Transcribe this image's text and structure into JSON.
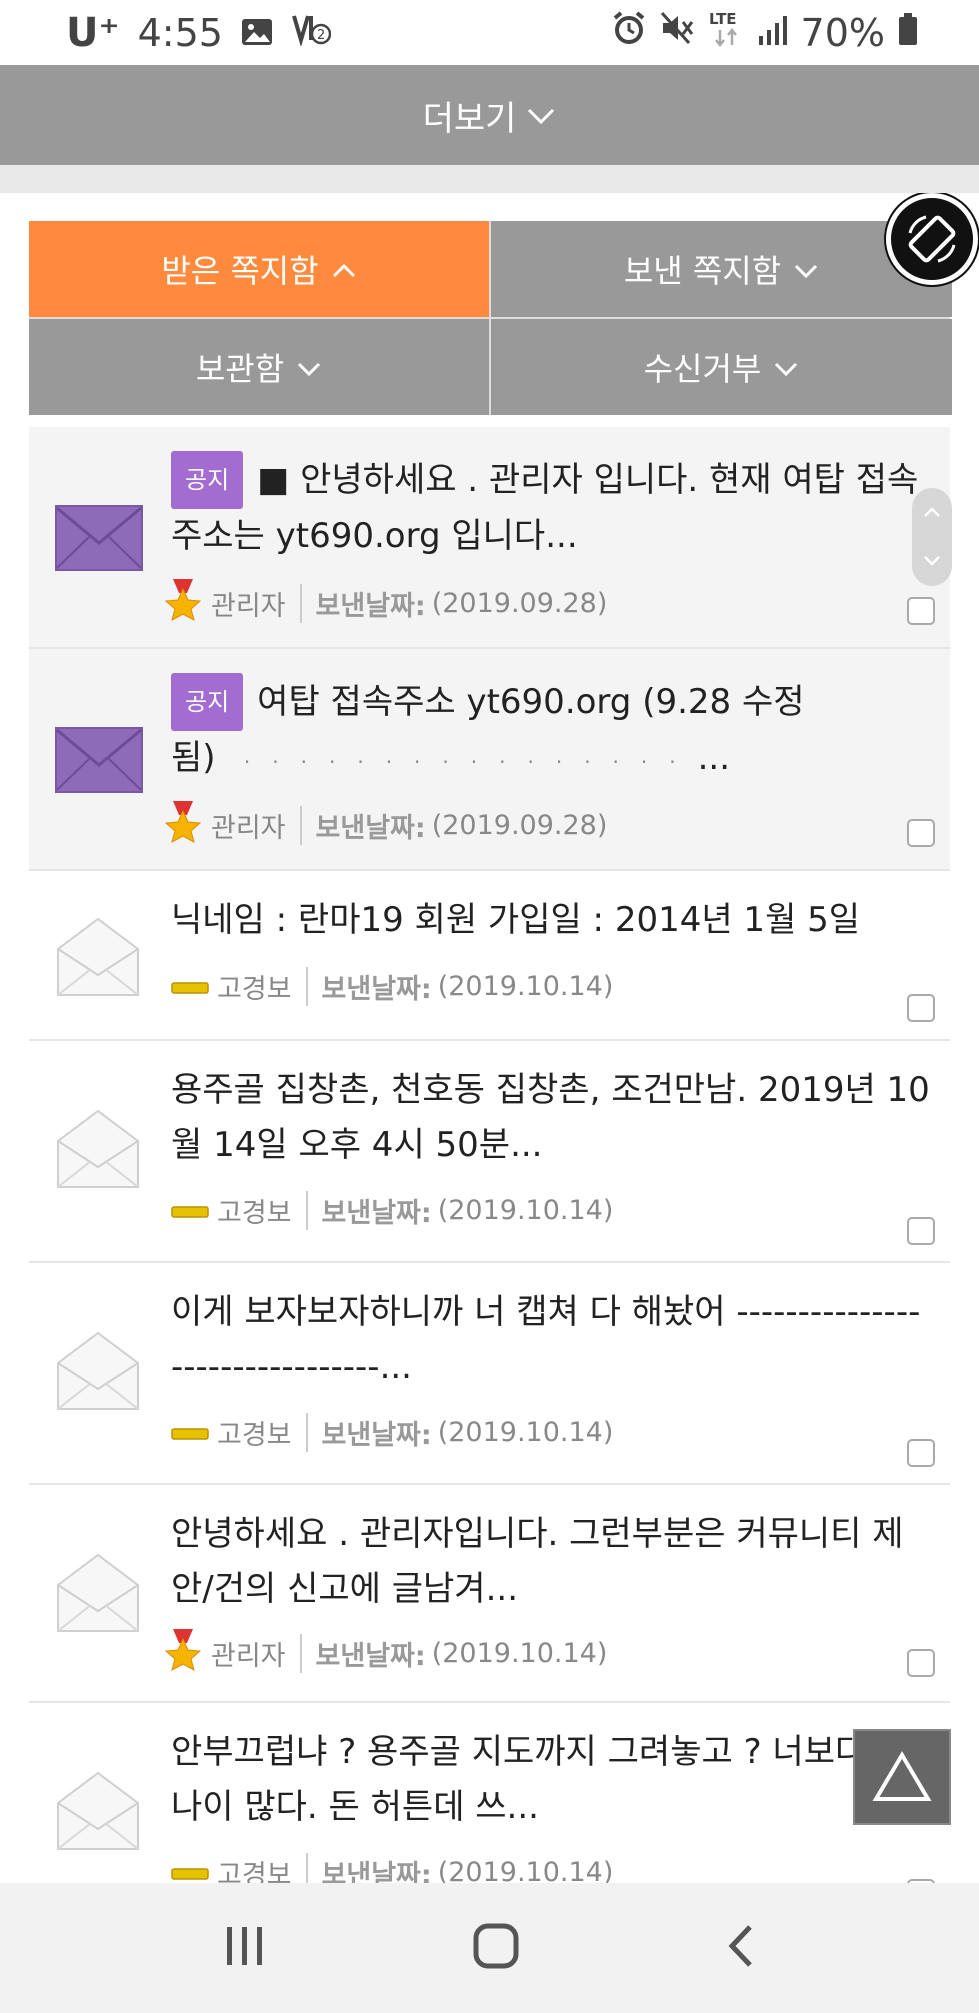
{
  "status": {
    "carrier": "U⁺",
    "time": "4:55",
    "battery": "70%",
    "network": "LTE",
    "icons": [
      "image-icon",
      "volte-icon",
      "alarm-icon",
      "mute-icon",
      "lte-icon",
      "signal-icon",
      "battery-icon"
    ]
  },
  "header": {
    "more_label": "더보기"
  },
  "tabs": [
    {
      "label": "받은 쪽지함",
      "active": true
    },
    {
      "label": "보낸 쪽지함",
      "active": false
    },
    {
      "label": "보관함",
      "active": false
    },
    {
      "label": "수신거부",
      "active": false
    }
  ],
  "date_label": "보낸날짜:",
  "notice_badge": "공지",
  "messages": [
    {
      "notice": true,
      "title": "■ 안녕하세요 . 관리자 입니다. 현재 여탑 접속 주소는 yt690.org 입니다...",
      "sender": "관리자",
      "date": "(2019.09.28)",
      "read": false
    },
    {
      "notice": true,
      "title_line1": "여탑 접속주소 yt690.org (9.28 수정",
      "title_line2": "됨)",
      "ellipsis": "...",
      "sender": "관리자",
      "date": "(2019.09.28)",
      "read": false
    },
    {
      "notice": false,
      "title": "닉네임 : 란마19 회원 가입일 : 2014년 1월 5일",
      "sender": "고경보",
      "date": "(2019.10.14)",
      "read": true
    },
    {
      "notice": false,
      "title": "용주골 집창촌, 천호동 집창촌, 조건만남. 2019년 10월 14일 오후 4시 50분...",
      "sender": "고경보",
      "date": "(2019.10.14)",
      "read": true
    },
    {
      "notice": false,
      "title": "이게 보자보자하니까 너 캡쳐 다 해놨어 --------------------------------...",
      "sender": "고경보",
      "date": "(2019.10.14)",
      "read": true
    },
    {
      "notice": false,
      "title": "안녕하세요 . 관리자입니다. 그런부분은 커뮤니티 제안/건의 신고에 글남겨...",
      "sender": "관리자",
      "date": "(2019.10.14)",
      "read": true
    },
    {
      "notice": false,
      "title": "안부끄럽냐 ? 용주골 지도까지 그려놓고 ? 너보다 나이 많다. 돈 허튼데 쓰...",
      "sender": "고경보",
      "date": "(2019.10.14)",
      "read": true
    }
  ],
  "colors": {
    "active_tab": "#ff8a3d",
    "tab": "#999999",
    "badge": "#a36cd0",
    "envelope_unread": "#8e6bb8"
  }
}
